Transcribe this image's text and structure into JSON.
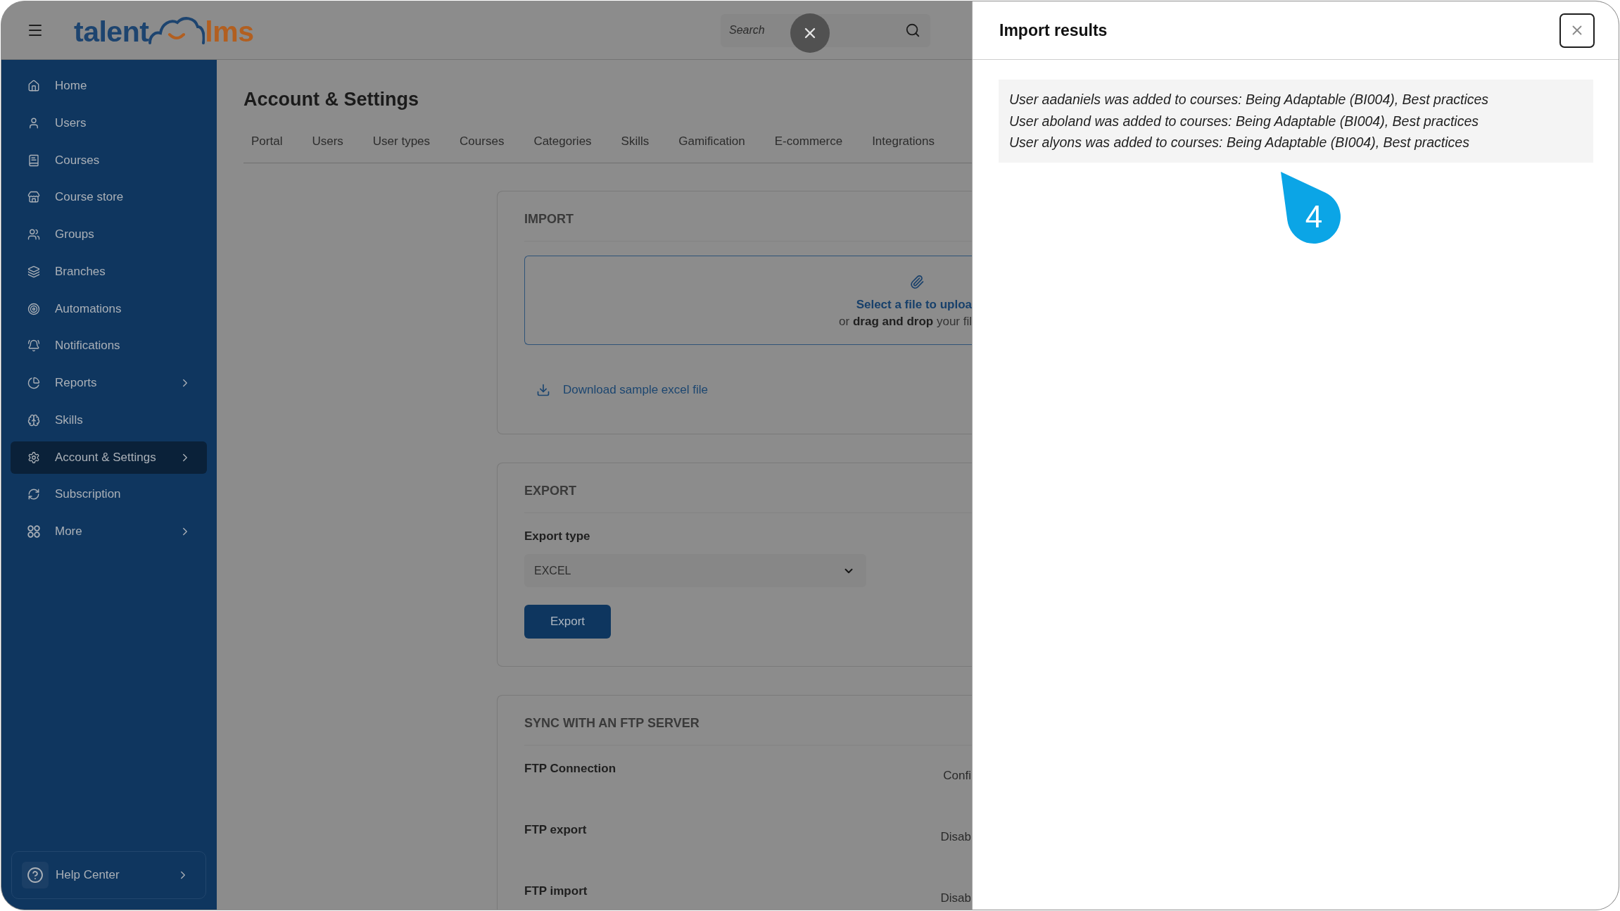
{
  "top_bar": {
    "logo": {
      "left": "talent",
      "right": "lms"
    },
    "search": {
      "placeholder": "Search"
    }
  },
  "sidebar": {
    "items": [
      {
        "label": "Home",
        "expandable": false,
        "selected": false
      },
      {
        "label": "Users",
        "expandable": false,
        "selected": false
      },
      {
        "label": "Courses",
        "expandable": false,
        "selected": false
      },
      {
        "label": "Course store",
        "expandable": false,
        "selected": false
      },
      {
        "label": "Groups",
        "expandable": false,
        "selected": false
      },
      {
        "label": "Branches",
        "expandable": false,
        "selected": false
      },
      {
        "label": "Automations",
        "expandable": false,
        "selected": false
      },
      {
        "label": "Notifications",
        "expandable": false,
        "selected": false
      },
      {
        "label": "Reports",
        "expandable": true,
        "selected": false
      },
      {
        "label": "Skills",
        "expandable": false,
        "selected": false
      },
      {
        "label": "Account & Settings",
        "expandable": true,
        "selected": true
      },
      {
        "label": "Subscription",
        "expandable": false,
        "selected": false
      },
      {
        "label": "More",
        "expandable": true,
        "selected": false
      }
    ],
    "help": {
      "label": "Help Center"
    }
  },
  "page": {
    "title": "Account & Settings",
    "tabs": [
      "Portal",
      "Users",
      "User types",
      "Courses",
      "Categories",
      "Skills",
      "Gamification",
      "E-commerce",
      "Integrations"
    ]
  },
  "import_section": {
    "title": "IMPORT",
    "dropzone": {
      "action": "Select a file to uploa",
      "hint": "or **drag and drop** your fil"
    },
    "sample_link": "Download sample excel file"
  },
  "export_section": {
    "title": "EXPORT",
    "field_label": "Export type",
    "select": {
      "value": "EXCEL"
    },
    "button": "Export"
  },
  "ftp_section": {
    "title": "SYNC WITH AN FTP SERVER",
    "rows": [
      {
        "label": "FTP Connection",
        "value": "Confi"
      },
      {
        "label": "FTP export",
        "value": "Disab"
      },
      {
        "label": "FTP import",
        "value": "Disab"
      }
    ]
  },
  "import_results": {
    "title": "Import results",
    "lines": [
      "User aadaniels was added to courses: Being Adaptable (BI004), Best practices",
      "User aboland was added to courses: Being Adaptable (BI004), Best practices",
      "User alyons was added to courses: Being Adaptable (BI004), Best practices"
    ]
  },
  "tour": {
    "step": "4"
  }
}
